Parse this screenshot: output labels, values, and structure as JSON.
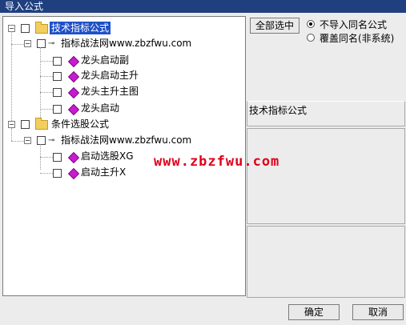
{
  "window": {
    "title": "导入公式"
  },
  "tree": {
    "root": "技术指标公式",
    "root_group": "指标战法网www.zbzfwu.com",
    "root_items": [
      "龙头启动副",
      "龙头启动主升",
      "龙头主升主图",
      "龙头启动"
    ],
    "second": "条件选股公式",
    "second_group": "指标战法网www.zbzfwu.com",
    "second_items": [
      "启动选股XG",
      "启动主升X"
    ]
  },
  "controls": {
    "select_all": "全部选中",
    "radio_no_import": "不导入同名公式",
    "radio_overwrite": "覆盖同名(非系统)",
    "info_label": "技术指标公式",
    "ok": "确定",
    "cancel": "取消"
  },
  "watermark": "www.zbzfwu.com"
}
